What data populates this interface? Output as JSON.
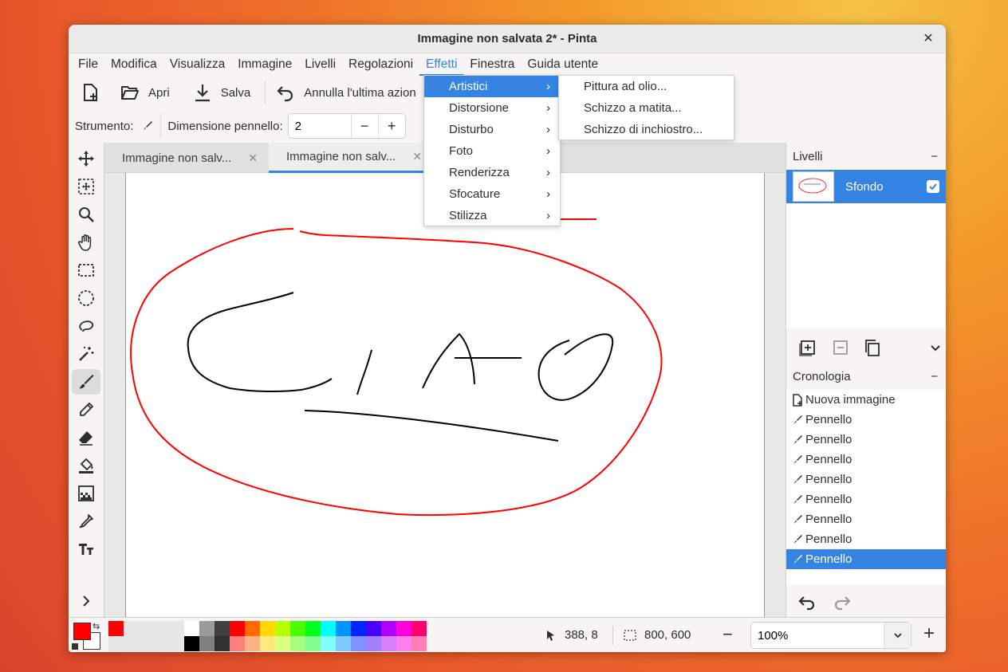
{
  "window": {
    "title": "Immagine non salvata 2* - Pinta"
  },
  "menubar": [
    "File",
    "Modifica",
    "Visualizza",
    "Immagine",
    "Livelli",
    "Regolazioni",
    "Effetti",
    "Finestra",
    "Guida utente"
  ],
  "toolbar": {
    "open": "Apri",
    "save": "Salva",
    "undo": "Annulla l'ultima azion"
  },
  "toolbar2": {
    "tool_label": "Strumento:",
    "brush_size_label": "Dimensione pennello:",
    "brush_size_value": "2"
  },
  "tabs": [
    {
      "label": "Immagine non salv..."
    },
    {
      "label": "Immagine non salv..."
    }
  ],
  "effects_menu": {
    "items": [
      "Artistici",
      "Distorsione",
      "Disturbo",
      "Foto",
      "Renderizza",
      "Sfocature",
      "Stilizza"
    ],
    "artistic_submenu": [
      "Pittura ad olio...",
      "Schizzo a matita...",
      "Schizzo di inchiostro..."
    ]
  },
  "layers": {
    "title": "Livelli",
    "items": [
      {
        "name": "Sfondo",
        "visible": true
      }
    ]
  },
  "history": {
    "title": "Cronologia",
    "items": [
      "Nuova immagine",
      "Pennello",
      "Pennello",
      "Pennello",
      "Pennello",
      "Pennello",
      "Pennello",
      "Pennello",
      "Pennello"
    ],
    "selected_index": 8
  },
  "status": {
    "cursor_pos": "388, 8",
    "image_size": "800, 600",
    "zoom": "100%"
  },
  "colors": {
    "accent": "#3584e4",
    "primary": "#ff0000",
    "secondary": "#ffffff",
    "palette_top": [
      "#ff0000",
      "#e6e6e6",
      "#e6e6e6",
      "#e6e6e6",
      "#e6e6e6",
      "#ffffff",
      "#9a9a9a",
      "#404040",
      "#ff0000",
      "#ff6a00",
      "#ffd800",
      "#b6ff00",
      "#4cff00",
      "#00ff21",
      "#00ffff",
      "#0094ff",
      "#0026ff",
      "#4800ff",
      "#b200ff",
      "#ff00dc",
      "#ff006e"
    ],
    "palette_bottom": [
      "#e6e6e6",
      "#e6e6e6",
      "#e6e6e6",
      "#e6e6e6",
      "#e6e6e6",
      "#000000",
      "#808080",
      "#303030",
      "#ff7f7f",
      "#ffb27f",
      "#ffe97f",
      "#daff7f",
      "#a5ff7f",
      "#7fff8e",
      "#7fffff",
      "#7fc9ff",
      "#7f92ff",
      "#a17fff",
      "#d67fff",
      "#ff7fed",
      "#ff7fb6"
    ]
  }
}
